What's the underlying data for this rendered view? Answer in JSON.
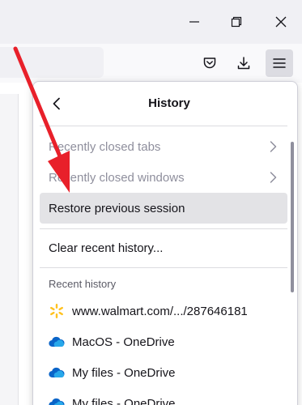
{
  "window": {
    "controls": {
      "minimize": "minimize-icon",
      "restore": "restore-icon",
      "close": "close-icon"
    }
  },
  "toolbar": {
    "icons": [
      "pocket-icon",
      "download-icon",
      "menu-icon"
    ]
  },
  "history_panel": {
    "title": "History",
    "items": {
      "recently_closed_tabs": "Recently closed tabs",
      "recently_closed_windows": "Recently closed windows",
      "restore_previous_session": "Restore previous session",
      "clear_recent_history": "Clear recent history..."
    },
    "recent_history_label": "Recent history",
    "recent_history": [
      {
        "label": "www.walmart.com/.../287646181",
        "icon": "walmart-spark-icon"
      },
      {
        "label": "MacOS - OneDrive",
        "icon": "onedrive-icon"
      },
      {
        "label": "My files - OneDrive",
        "icon": "onedrive-icon"
      },
      {
        "label": "My files - OneDrive",
        "icon": "onedrive-icon"
      }
    ]
  },
  "colors": {
    "annotation_arrow": "#e8202a",
    "walmart_yellow": "#ffc220",
    "onedrive_blue": "#0a64c8"
  }
}
